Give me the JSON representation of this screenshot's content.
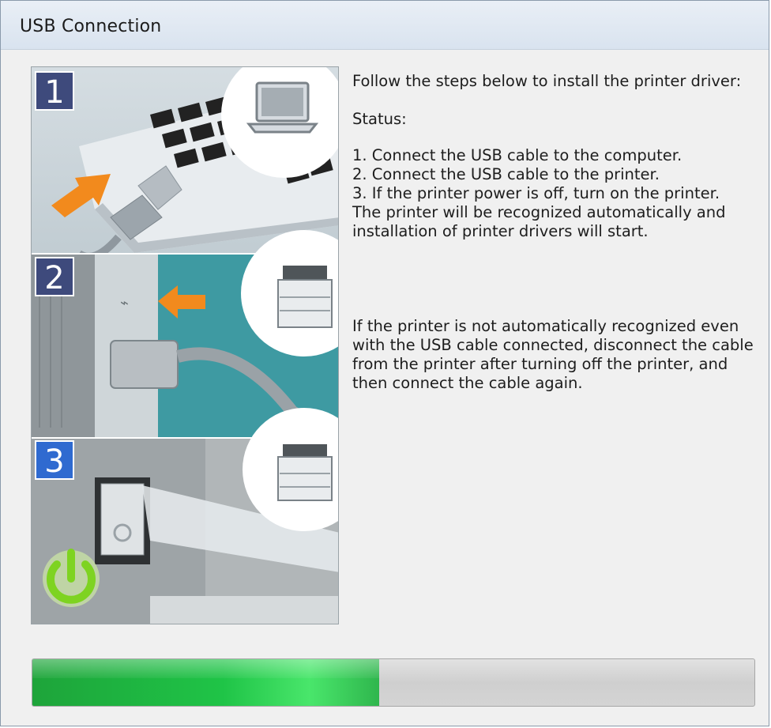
{
  "window": {
    "title": "USB Connection"
  },
  "illustration": {
    "steps": [
      {
        "number": "1",
        "icon": "laptop-icon"
      },
      {
        "number": "2",
        "icon": "printer-icon"
      },
      {
        "number": "3",
        "icon": "power-icon"
      }
    ]
  },
  "instructions": {
    "intro": "Follow the steps below to install the printer driver:",
    "status_label": "Status:",
    "steps": [
      "1. Connect the USB cable to the computer.",
      "2. Connect the USB cable to the printer.",
      "3. If the printer power is off, turn on the printer."
    ],
    "auto_text": "The printer will be recognized automatically and installation of printer drivers will start.",
    "note": "If the printer is not automatically recognized even with the USB cable connected, disconnect the cable from the printer after turning off the printer, and then connect the cable again."
  },
  "progress": {
    "fraction": 0.48,
    "color": "#1fc447"
  }
}
